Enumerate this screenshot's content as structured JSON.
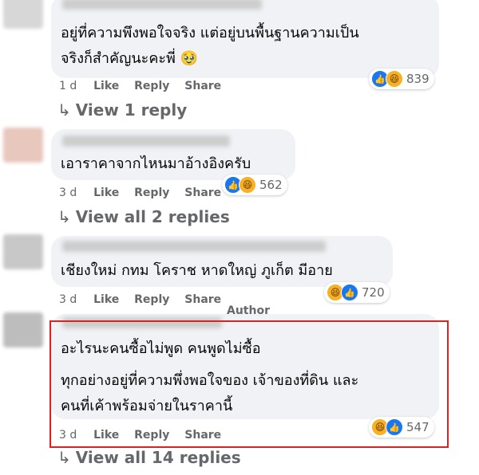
{
  "comments": [
    {
      "lines": [
        "อยู่ที่ความพึงพอใจจริง แต่อยู่บนพื้นฐานความเป็น",
        "จริงก็สำคัญนะคะพี่ 🥹"
      ],
      "time": "1 d",
      "like": "Like",
      "reply": "Reply",
      "share": "Share",
      "reactions": "839",
      "replies_link": "View 1 reply"
    },
    {
      "lines": [
        "เอาราคาจากไหนมาอ้างอิงครับ"
      ],
      "time": "3 d",
      "like": "Like",
      "reply": "Reply",
      "share": "Share",
      "reactions": "562",
      "replies_link": "View all 2 replies"
    },
    {
      "lines": [
        "เชียงใหม่ กทม โคราช หาดใหญ่ ภูเก็ต มีอาย"
      ],
      "time": "3 d",
      "like": "Like",
      "reply": "Reply",
      "share": "Share",
      "reactions": "720"
    },
    {
      "author_badge": "Author",
      "lines": [
        "อะไรนะคนซื้อไม่พูด คนพูดไม่ซื้อ",
        "ทุกอย่างอยู่ที่ความพึ่งพอใจของ เจ้าของที่ดิน และ",
        "คนที่เค้าพร้อมจ่ายในราคานี้"
      ],
      "time": "3 d",
      "like": "Like",
      "reply": "Reply",
      "share": "Share",
      "reactions": "547",
      "replies_link": "View all 14 replies"
    }
  ],
  "icons": {
    "arrow": "↳",
    "like": "👍",
    "haha": "😆"
  },
  "colors": {
    "highlight_border": "#e0201f",
    "bubble": "#f0f2f5",
    "meta_text": "#65676b"
  }
}
